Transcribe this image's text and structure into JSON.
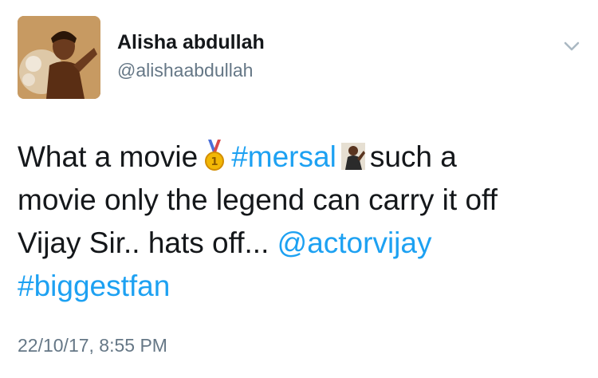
{
  "user": {
    "display_name": "Alisha abdullah",
    "handle": "@alishaabdullah"
  },
  "tweet": {
    "line1_part1": "What a movie",
    "hashtag_mersal": "#mersal",
    "line1_part2": "such a",
    "line2": "movie only the legend can carry it off",
    "line3_text": "Vijay Sir.. hats off...",
    "mention": "@actorvijay",
    "hashtag_biggestfan": "#biggestfan",
    "emoji_1": "medal-icon",
    "emoji_2": "man-photo-emoji"
  },
  "timestamp": "22/10/17, 8:55 PM",
  "colors": {
    "link": "#1da1f2",
    "secondary_text": "#657786",
    "primary_text": "#14171a"
  }
}
